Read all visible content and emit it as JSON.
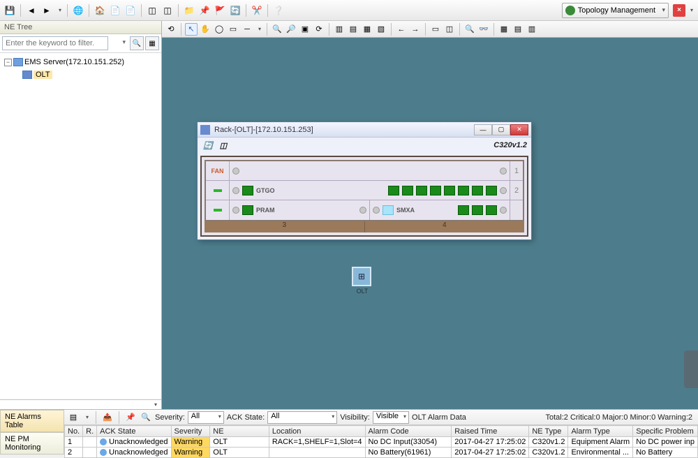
{
  "top_combo": "Topology Management",
  "left": {
    "title": "NE Tree",
    "filter_placeholder": "Enter the keyword to filter.",
    "root": "EMS Server(172.10.151.252)",
    "child": "OLT"
  },
  "rack": {
    "title": "Rack-[OLT]-[172.10.151.253]",
    "model": "C320v1.2",
    "rows": {
      "fan": "FAN",
      "gtgo": "GTGO",
      "pram": "PRAM",
      "smxa": "SMXA"
    },
    "slots": {
      "s1": "1",
      "s2": "2",
      "b3": "3",
      "b4": "4"
    }
  },
  "node_label": "OLT",
  "bottom": {
    "tabs": {
      "alarms": "NE Alarms Table",
      "pm": "NE PM Monitoring"
    },
    "labels": {
      "severity": "Severity:",
      "ack": "ACK State:",
      "visibility": "Visibility:",
      "data": "OLT Alarm Data"
    },
    "sel": {
      "all": "All",
      "visible": "Visible"
    },
    "summary": "Total:2 Critical:0 Major:0 Minor:0 Warning:2",
    "cols": {
      "no": "No.",
      "r": "R.",
      "ack": "ACK State",
      "sev": "Severity",
      "ne": "NE",
      "loc": "Location",
      "code": "Alarm Code",
      "time": "Raised Time",
      "type": "NE Type",
      "atype": "Alarm Type",
      "prob": "Specific Problem"
    },
    "rows": [
      {
        "no": "1",
        "ack": "Unacknowledged",
        "sev": "Warning",
        "ne": "OLT",
        "loc": "RACK=1,SHELF=1,Slot=4",
        "code": "No DC Input(33054)",
        "time": "2017-04-27 17:25:02",
        "type": "C320v1.2",
        "atype": "Equipment Alarm",
        "prob": "No DC power inp"
      },
      {
        "no": "2",
        "ack": "Unacknowledged",
        "sev": "Warning",
        "ne": "OLT",
        "loc": "",
        "code": "No Battery(61961)",
        "time": "2017-04-27 17:25:02",
        "type": "C320v1.2",
        "atype": "Environmental ...",
        "prob": "No Battery"
      }
    ]
  }
}
